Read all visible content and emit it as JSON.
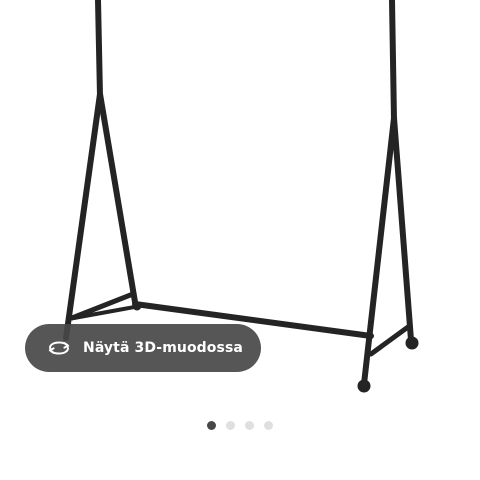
{
  "product_view": {
    "product_image": "clothes-rack-black",
    "view_3d_button": {
      "label": "Näytä 3D-muodossa",
      "icon": "rotate-360-icon"
    },
    "pager": {
      "count": 4,
      "active_index": 0
    }
  },
  "colors": {
    "button_bg": "#484848",
    "button_text": "#ffffff",
    "dot_active": "#484848",
    "dot_inactive": "#dfdfdf",
    "rack": "#242424"
  }
}
